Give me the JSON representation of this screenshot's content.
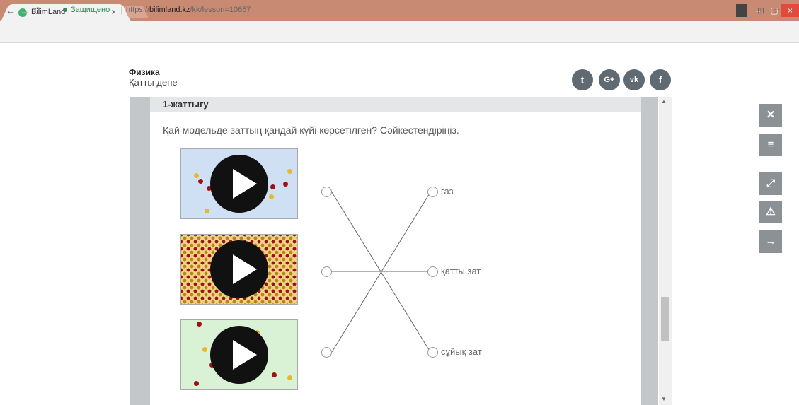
{
  "browser": {
    "tab_title": "BilimLand",
    "tab_close": "×",
    "secure_label": "Защищено",
    "url_prefix": "https://",
    "url_host": "bilimland.kz",
    "url_path": "/kk/lesson=10657",
    "url_separator": "|"
  },
  "icons": {
    "back": "←",
    "forward": "→",
    "reload": "C",
    "translate": "⊞",
    "star": "☆",
    "menu": "⋮",
    "minimize": "–",
    "maximize": "▢",
    "close": "×"
  },
  "course": {
    "subject": "Физика",
    "topic": "Қатты дене"
  },
  "social": [
    {
      "name": "twitter-icon",
      "glyph": "t"
    },
    {
      "name": "google-plus-icon",
      "glyph": "G+"
    },
    {
      "name": "vk-icon",
      "glyph": "vk"
    },
    {
      "name": "facebook-icon",
      "glyph": "f"
    }
  ],
  "exercise": {
    "title": "1-жаттығу",
    "question": "Қай модельде заттың қандай күйі көрсетілген? Сәйкестендіріңіз.",
    "answers": [
      "газ",
      "қатты зат",
      "сұйық зат"
    ]
  },
  "scroll": {
    "up": "▲",
    "down": "▼"
  },
  "side_buttons": [
    {
      "name": "close-icon",
      "glyph": "✕"
    },
    {
      "name": "menu-icon",
      "glyph": "≡"
    },
    {
      "name": "expand-icon",
      "glyph": "⤢"
    },
    {
      "name": "warning-icon",
      "glyph": "⚠"
    },
    {
      "name": "arrow-right-icon",
      "glyph": "→"
    }
  ],
  "colors": {
    "titlebar": "#c98a73",
    "side_button": "#8b9195",
    "social": "#5f6a72",
    "secure": "#2e8b57"
  }
}
